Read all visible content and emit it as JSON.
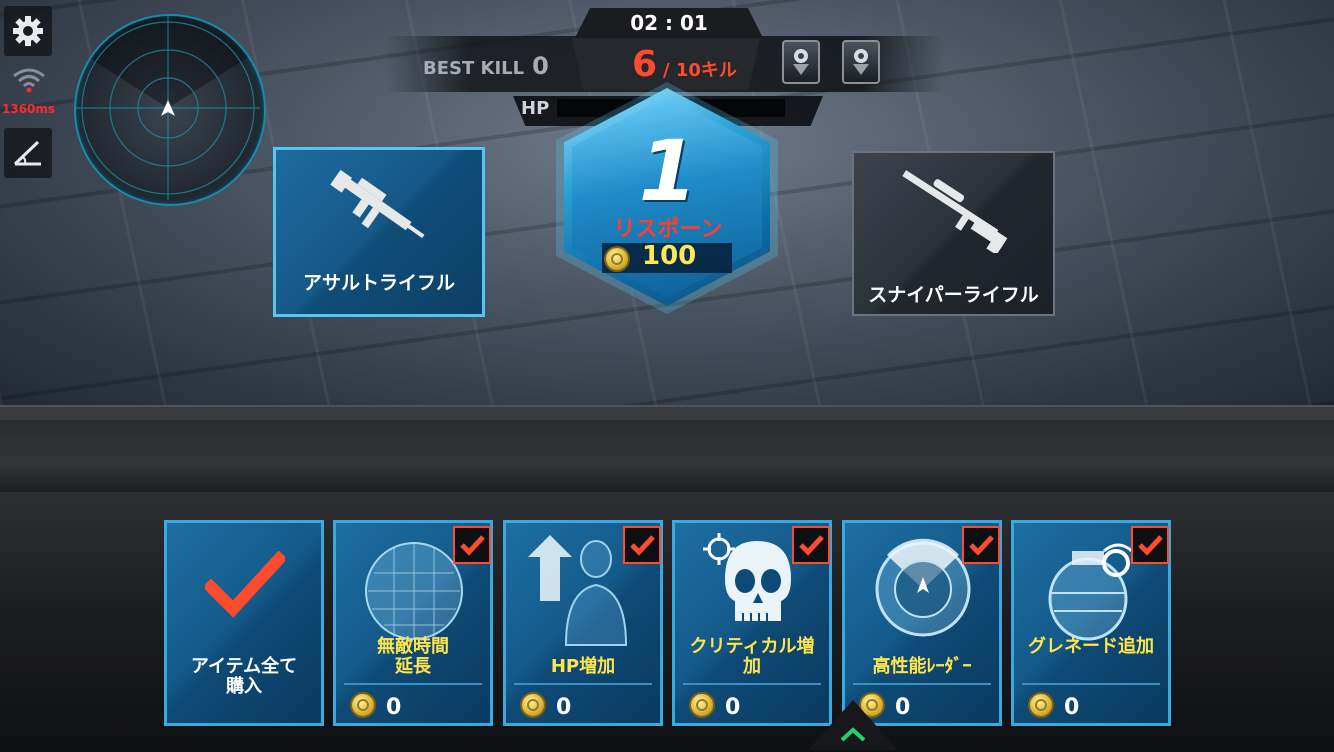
{
  "hud": {
    "timer": "02 : 01",
    "best_kill_label": "BEST KILL",
    "best_kill_value": "0",
    "kill_count": "6",
    "kill_target": "/ 10キル",
    "hp_label": "HP",
    "hp_fill": 0,
    "ping": "1360ms"
  },
  "weapons": {
    "primary": {
      "label": "アサルトライフル",
      "selected": true
    },
    "secondary": {
      "label": "スナイパーライフル",
      "selected": false
    }
  },
  "respawn": {
    "count": "1",
    "label": "リスポーン",
    "cost": "100"
  },
  "items": [
    {
      "label": "アイテム全て購入",
      "price": ""
    },
    {
      "label": "無敵時間延長",
      "price": "0"
    },
    {
      "label": "HP増加",
      "price": "0"
    },
    {
      "label": "クリティカル増加",
      "price": "0"
    },
    {
      "label": "高性能ﾚｰﾀﾞｰ",
      "price": "0"
    },
    {
      "label": "グレネード追加",
      "price": "0"
    }
  ],
  "colors": {
    "accent_red": "#ff4b2d",
    "label_yellow": "#ffe54b",
    "card_blue": "#1d6ea3",
    "radar_ring": "#1b8aa8"
  },
  "icons": [
    "gear-icon",
    "wifi-icon",
    "angle-icon",
    "radar-icon",
    "medal-icon",
    "assault-rifle-icon",
    "sniper-rifle-icon",
    "coin-icon",
    "check-icon",
    "shield-sphere-icon",
    "body-up-icon",
    "skull-crosshair-icon",
    "radar-dish-icon",
    "grenade-icon",
    "chevron-up-icon"
  ]
}
